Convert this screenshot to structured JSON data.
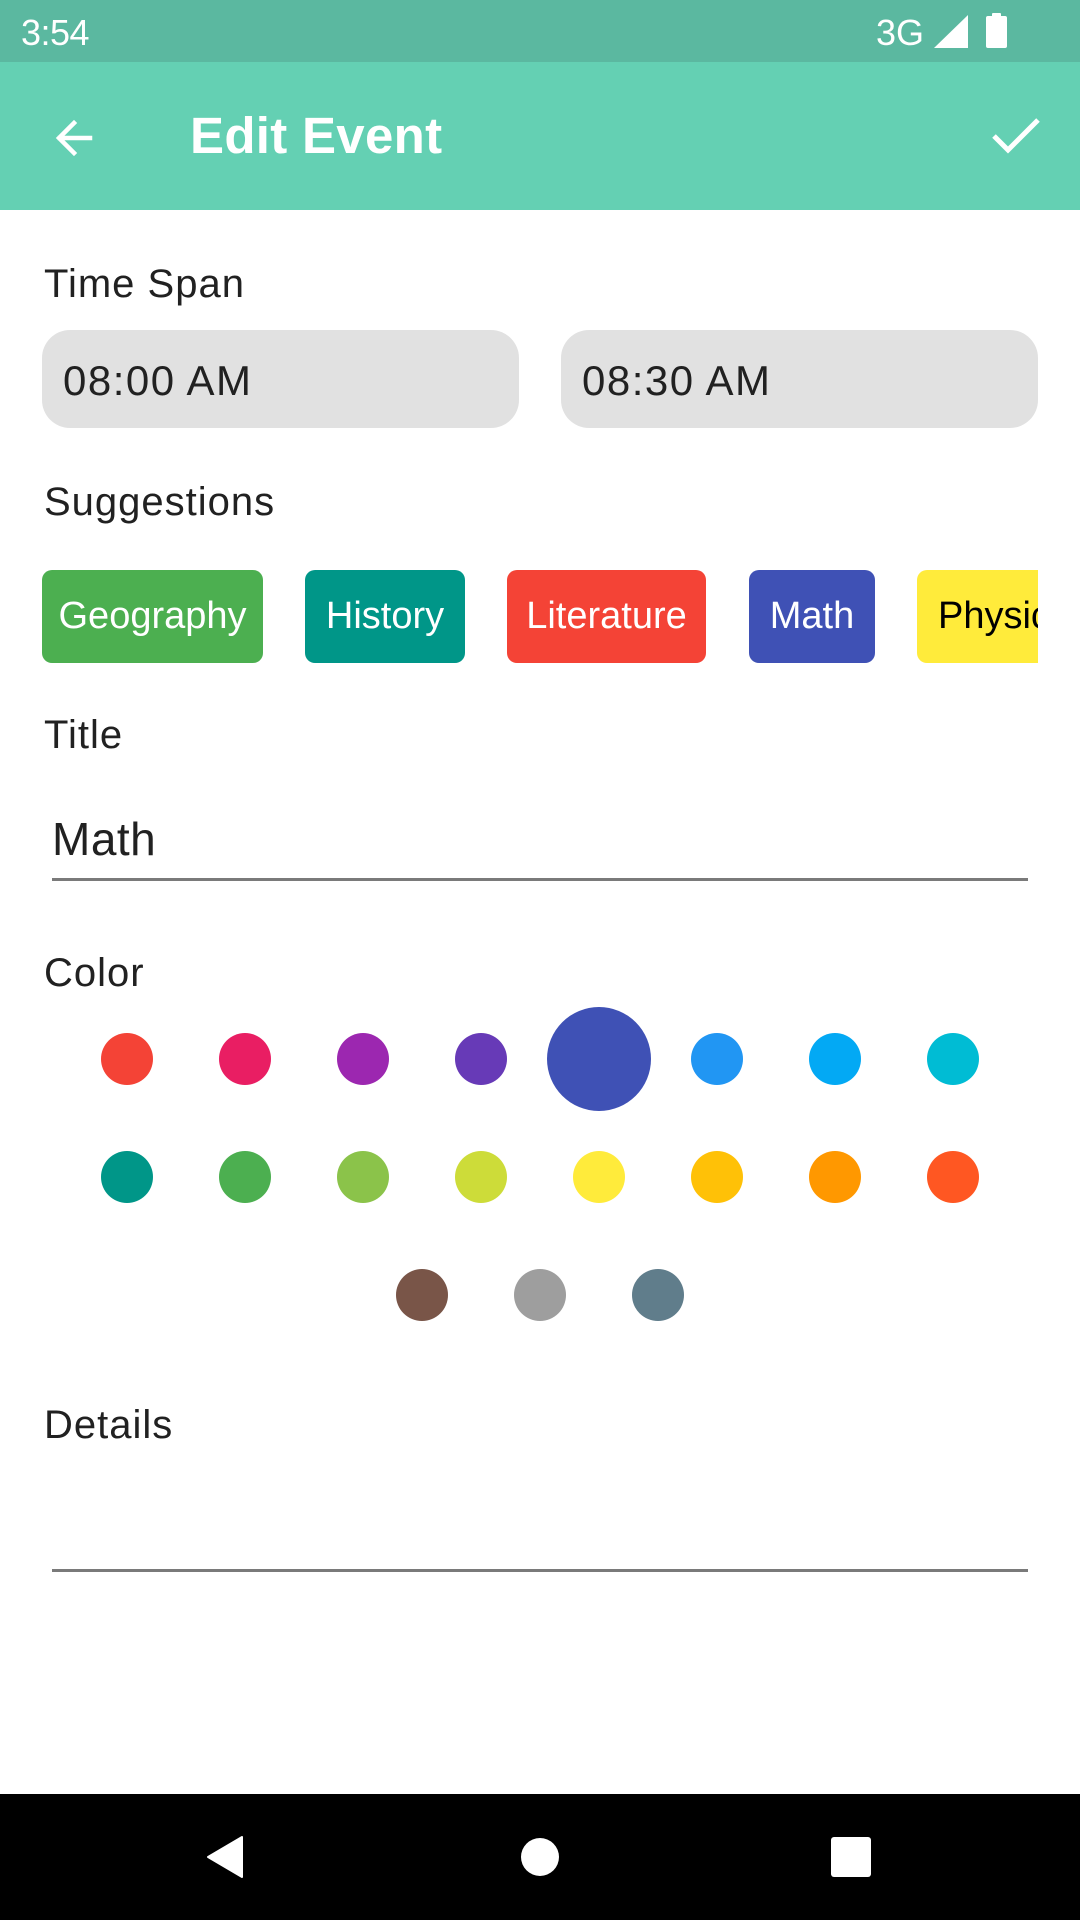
{
  "status_bar": {
    "time": "3:54",
    "network": "3G",
    "icons": [
      "signal-icon",
      "battery-icon"
    ]
  },
  "app_bar": {
    "title": "Edit Event",
    "back_icon": "arrow-back-icon",
    "confirm_icon": "check-icon",
    "background_color": "#64d0b3"
  },
  "time_span": {
    "label": "Time Span",
    "start": "08:00 AM",
    "end": "08:30 AM"
  },
  "suggestions": {
    "label": "Suggestions",
    "chips": [
      {
        "label": "Geography",
        "color": "#4caf50",
        "text_color": "#ffffff"
      },
      {
        "label": "History",
        "color": "#009688",
        "text_color": "#ffffff"
      },
      {
        "label": "Literature",
        "color": "#f44336",
        "text_color": "#ffffff"
      },
      {
        "label": "Math",
        "color": "#3f51b5",
        "text_color": "#ffffff"
      },
      {
        "label": "Physics",
        "color": "#ffeb3b",
        "text_color": "#000000"
      }
    ]
  },
  "title_field": {
    "label": "Title",
    "value": "Math"
  },
  "color_picker": {
    "label": "Color",
    "selected": "#3f51b5",
    "colors": [
      "#f44336",
      "#e91e63",
      "#9c27b0",
      "#673ab7",
      "#3f51b5",
      "#2196f3",
      "#03a9f4",
      "#00bcd4",
      "#009688",
      "#4caf50",
      "#8bc34a",
      "#cddc39",
      "#ffeb3b",
      "#ffc107",
      "#ff9800",
      "#ff5722",
      "#795548",
      "#9e9e9e",
      "#607d8b"
    ]
  },
  "details_field": {
    "label": "Details",
    "value": ""
  },
  "nav_bar": {
    "back": "nav-back-icon",
    "home": "nav-home-icon",
    "recents": "nav-recents-icon"
  }
}
